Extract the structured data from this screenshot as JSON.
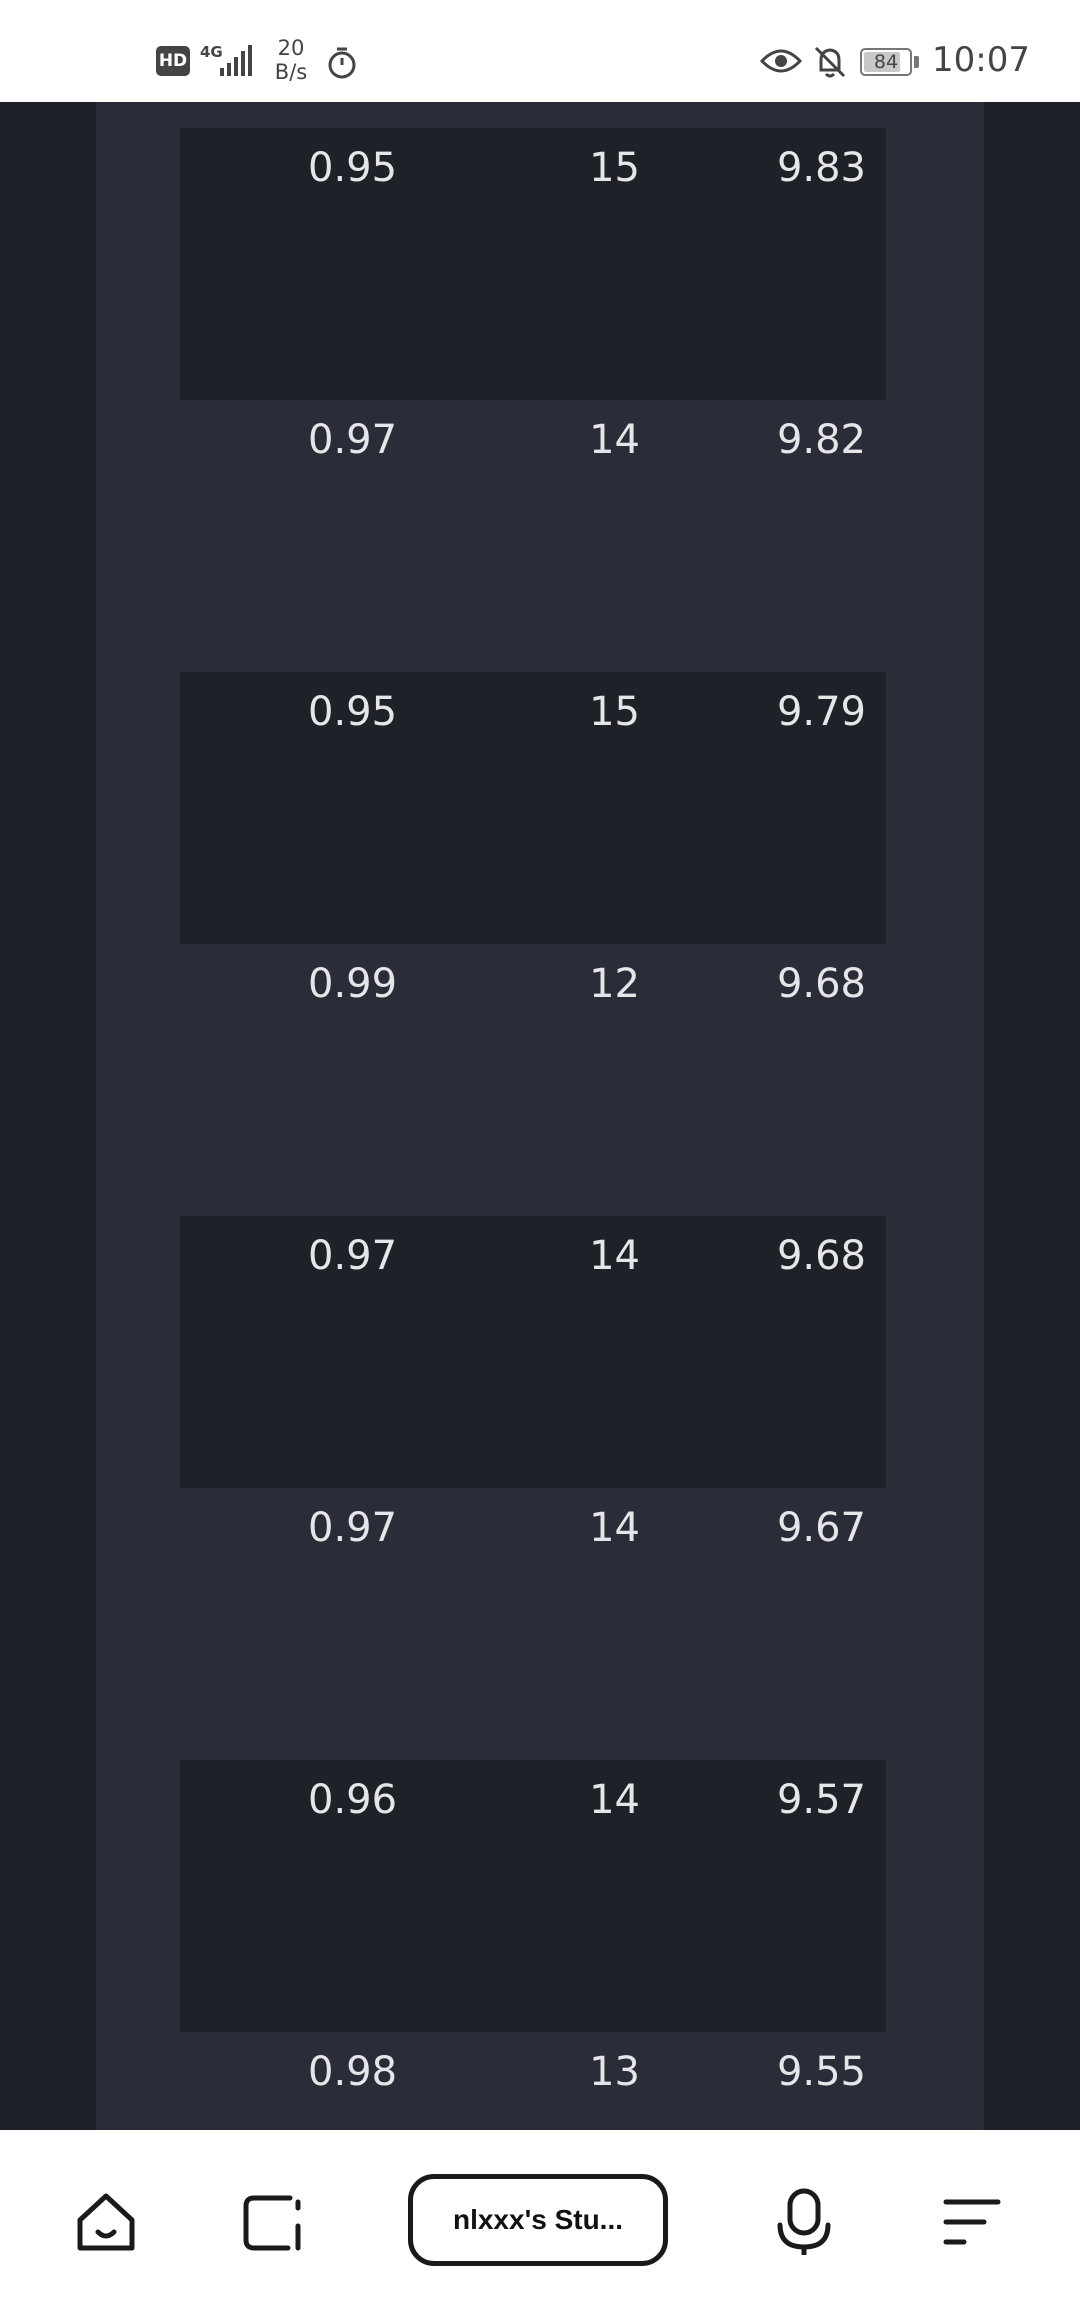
{
  "status_bar": {
    "hd_label": "HD",
    "network_type": "4G",
    "net_speed_value": "20",
    "net_speed_unit": "B/s",
    "battery_level": "84",
    "battery_fraction": 0.84,
    "time": "10:07",
    "icons": [
      "signal-icon",
      "timer-icon",
      "eye-icon",
      "bell-off-icon",
      "battery-icon"
    ]
  },
  "table": {
    "rows": [
      {
        "col_a": "0.95",
        "col_b": "15",
        "col_c": "9.83"
      },
      {
        "col_a": "0.97",
        "col_b": "14",
        "col_c": "9.82"
      },
      {
        "col_a": "0.95",
        "col_b": "15",
        "col_c": "9.79"
      },
      {
        "col_a": "0.99",
        "col_b": "12",
        "col_c": "9.68"
      },
      {
        "col_a": "0.97",
        "col_b": "14",
        "col_c": "9.68"
      },
      {
        "col_a": "0.97",
        "col_b": "14",
        "col_c": "9.67"
      },
      {
        "col_a": "0.96",
        "col_b": "14",
        "col_c": "9.57"
      },
      {
        "col_a": "0.98",
        "col_b": "13",
        "col_c": "9.55"
      }
    ]
  },
  "bottom_nav": {
    "address_label": "nlxxx's Stu...",
    "icons": [
      "home-icon",
      "tabs-icon",
      "microphone-icon",
      "menu-icon"
    ]
  },
  "colors": {
    "page_bg": "#1f2129",
    "panel_bg": "#2a2d37",
    "row_dark": "#1f2129",
    "text": "#e6e6e9"
  }
}
